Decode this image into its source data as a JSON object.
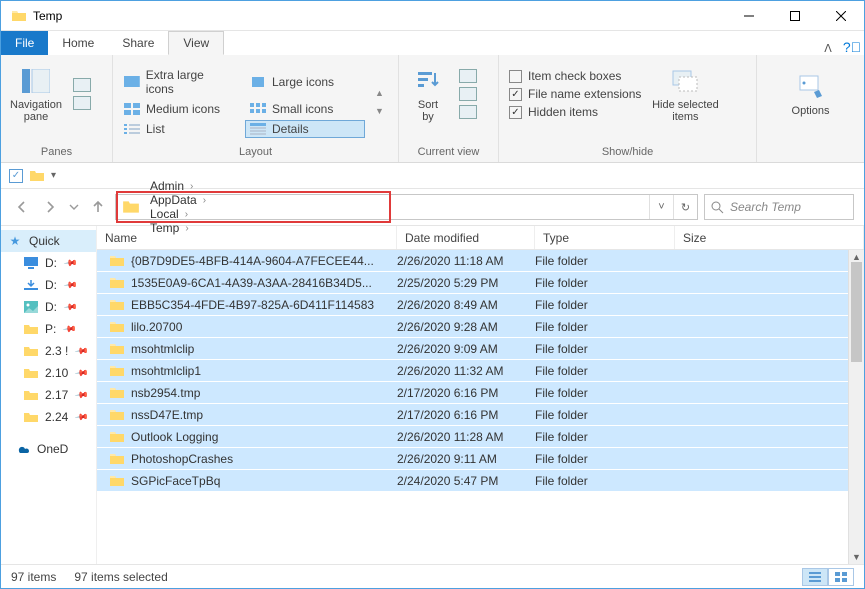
{
  "window": {
    "title": "Temp"
  },
  "tabs": {
    "file": "File",
    "home": "Home",
    "share": "Share",
    "view": "View"
  },
  "ribbon": {
    "panes": {
      "nav": "Navigation\npane",
      "label": "Panes"
    },
    "layout": {
      "xlarge": "Extra large icons",
      "large": "Large icons",
      "medium": "Medium icons",
      "small": "Small icons",
      "list": "List",
      "details": "Details",
      "label": "Layout"
    },
    "sort": {
      "btn": "Sort\nby",
      "label": "Current view"
    },
    "showhide": {
      "check_boxes": "Item check boxes",
      "extensions": "File name extensions",
      "hidden": "Hidden items",
      "hide_btn": "Hide selected\nitems",
      "label": "Show/hide"
    },
    "options": "Options"
  },
  "breadcrumb": [
    "Admin",
    "AppData",
    "Local",
    "Temp"
  ],
  "search": {
    "placeholder": "Search Temp"
  },
  "columns": {
    "name": "Name",
    "date": "Date modified",
    "type": "Type",
    "size": "Size"
  },
  "sidebar": {
    "quick": "Quick",
    "items": [
      {
        "label": "D:",
        "icon": "monitor"
      },
      {
        "label": "D:",
        "icon": "download"
      },
      {
        "label": "D:",
        "icon": "picture"
      },
      {
        "label": "P:",
        "icon": "folder"
      },
      {
        "label": "2.3 !",
        "icon": "folder"
      },
      {
        "label": "2.10",
        "icon": "folder"
      },
      {
        "label": "2.17",
        "icon": "folder"
      },
      {
        "label": "2.24",
        "icon": "folder"
      }
    ],
    "onedrive": "OneD"
  },
  "files": [
    {
      "name": "{0B7D9DE5-4BFB-414A-9604-A7FECEE44...",
      "date": "2/26/2020 11:18 AM",
      "type": "File folder"
    },
    {
      "name": "1535E0A9-6CA1-4A39-A3AA-28416B34D5...",
      "date": "2/25/2020 5:29 PM",
      "type": "File folder"
    },
    {
      "name": "EBB5C354-4FDE-4B97-825A-6D411F114583",
      "date": "2/26/2020 8:49 AM",
      "type": "File folder"
    },
    {
      "name": "lilo.20700",
      "date": "2/26/2020 9:28 AM",
      "type": "File folder"
    },
    {
      "name": "msohtmlclip",
      "date": "2/26/2020 9:09 AM",
      "type": "File folder"
    },
    {
      "name": "msohtmlclip1",
      "date": "2/26/2020 11:32 AM",
      "type": "File folder"
    },
    {
      "name": "nsb2954.tmp",
      "date": "2/17/2020 6:16 PM",
      "type": "File folder"
    },
    {
      "name": "nssD47E.tmp",
      "date": "2/17/2020 6:16 PM",
      "type": "File folder"
    },
    {
      "name": "Outlook Logging",
      "date": "2/26/2020 11:28 AM",
      "type": "File folder"
    },
    {
      "name": "PhotoshopCrashes",
      "date": "2/26/2020 9:11 AM",
      "type": "File folder"
    },
    {
      "name": "SGPicFaceTpBq",
      "date": "2/24/2020 5:47 PM",
      "type": "File folder"
    }
  ],
  "status": {
    "count": "97 items",
    "selected": "97 items selected"
  }
}
